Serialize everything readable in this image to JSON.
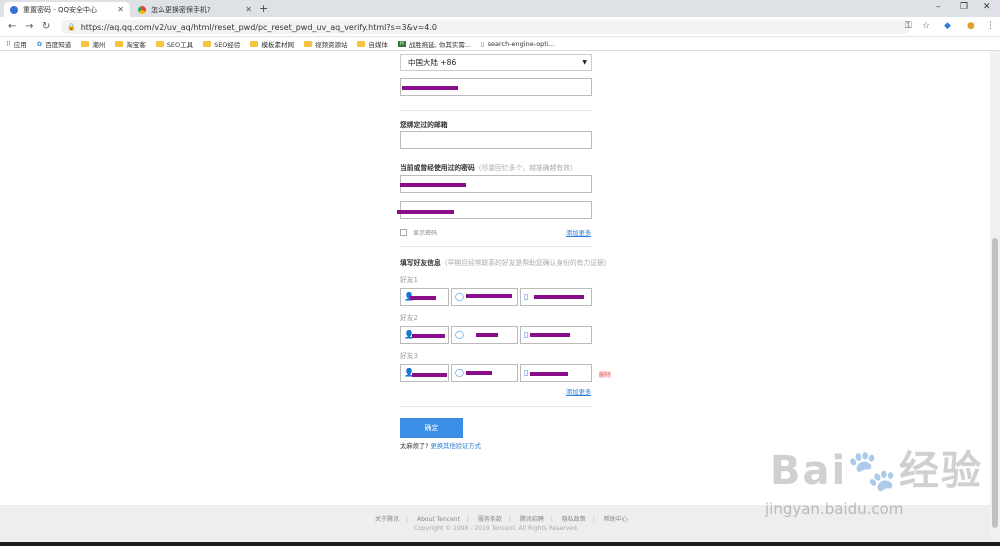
{
  "browser": {
    "tabs": [
      {
        "title": "重置密码 - QQ安全中心",
        "active": true
      },
      {
        "title": "怎么更换密保手机?",
        "active": false
      }
    ],
    "url": "https://aq.qq.com/v2/uv_aq/html/reset_pwd/pc_reset_pwd_uv_aq_verify.html?s=3&v=4.0",
    "bookmarks": [
      "应用",
      "百度知道",
      "潮州",
      "淘宝客",
      "SEO工具",
      "SEO经验",
      "模板素材网",
      "视频资源站",
      "自媒体",
      "战胜拖延, 你其实需...",
      "search-engine-opti..."
    ]
  },
  "form": {
    "country_select": "中国大陆 +86",
    "email_label": "您绑定过的邮箱",
    "password_label": "当前或曾经使用过的密码",
    "password_hint": "（尽量回忆多个，越准确越有效）",
    "show_password": "显示密码",
    "add_more": "添加更多",
    "friends_label": "填写好友信息",
    "friends_hint": "（早期且经常联系的好友是帮助您确认身份的有力证据）",
    "friends": [
      "好友1",
      "好友2",
      "好友3"
    ],
    "delete": "删除",
    "add_more_friends": "添加更多",
    "submit": "确定",
    "trouble_text": "太麻烦了?",
    "trouble_link": "更换其他验证方式"
  },
  "footer": {
    "links": [
      "关于腾讯",
      "About Tencent",
      "服务条款",
      "腾讯招聘",
      "隐私政策",
      "帮助中心"
    ],
    "copyright": "Copyright © 1998 - 2019 Tencent. All Rights Reserved."
  },
  "watermark": {
    "logo": "Bai经验",
    "url": "jingyan.baidu.com"
  },
  "colors": {
    "accent": "#3a8ee6",
    "redaction": "#8a0d8a",
    "link": "#2d7ed6"
  }
}
